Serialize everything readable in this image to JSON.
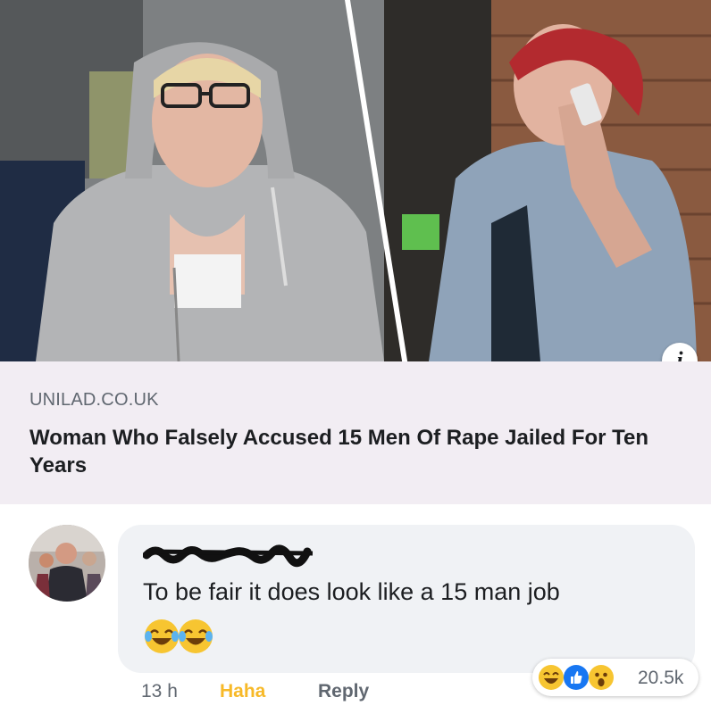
{
  "link_preview": {
    "domain": "UNILAD.CO.UK",
    "headline": "Woman Who Falsely Accused 15 Men Of Rape Jailed For Ten Years",
    "info_icon_glyph": "i"
  },
  "comment": {
    "text": "To be fair it does look like a 15 man job",
    "emojis": [
      "face-with-tears-of-joy",
      "face-with-tears-of-joy"
    ],
    "time": "13 h",
    "reaction_label": "Haha",
    "reply_label": "Reply",
    "reactions": [
      "haha",
      "like",
      "wow"
    ],
    "reaction_count": "20.5k"
  },
  "colors": {
    "haha": "#f7b928",
    "like": "#1877f2",
    "bubble": "#f0f2f5",
    "meta_bg": "#f2edf3"
  }
}
